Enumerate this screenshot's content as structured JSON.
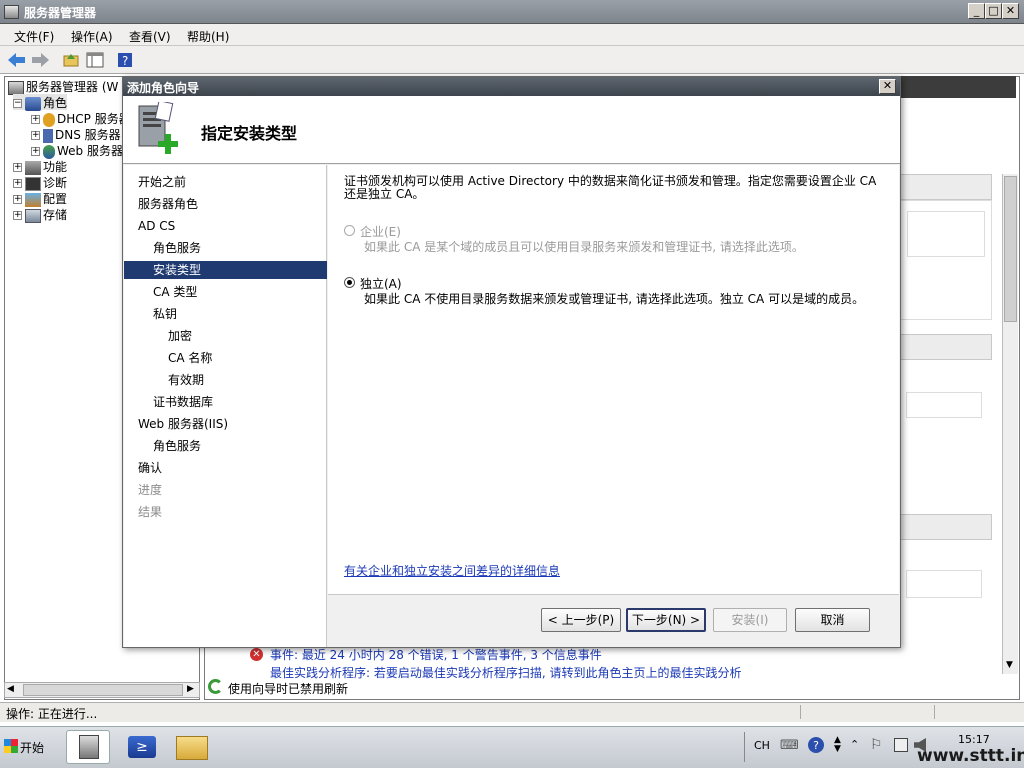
{
  "main_window": {
    "title": "服务器管理器",
    "menu": [
      "文件(F)",
      "操作(A)",
      "查看(V)",
      "帮助(H)"
    ],
    "tree": {
      "root": "服务器管理器 (W",
      "items": [
        {
          "label": "角色",
          "expanded": true
        },
        {
          "label": "DHCP 服务器"
        },
        {
          "label": "DNS 服务器"
        },
        {
          "label": "Web 服务器"
        },
        {
          "label": "功能"
        },
        {
          "label": "诊断"
        },
        {
          "label": "配置"
        },
        {
          "label": "存储"
        }
      ]
    },
    "refresh_notice": "使用向导时已禁用刷新",
    "events_line1": "事件: 最近 24 小时内 28 个错误, 1 个警告事件, 3 个信息事件",
    "events_line2": "最佳实践分析程序: 若要启动最佳实践分析程序扫描, 请转到此角色主页上的最佳实践分析",
    "status": "操作: 正在进行..."
  },
  "dialog": {
    "title": "添加角色向导",
    "heading": "指定安装类型",
    "nav": [
      {
        "label": "开始之前",
        "level": 0,
        "state": "normal"
      },
      {
        "label": "服务器角色",
        "level": 0,
        "state": "normal"
      },
      {
        "label": "AD CS",
        "level": 0,
        "state": "normal"
      },
      {
        "label": "角色服务",
        "level": 1,
        "state": "normal"
      },
      {
        "label": "安装类型",
        "level": 1,
        "state": "selected"
      },
      {
        "label": "CA 类型",
        "level": 1,
        "state": "normal"
      },
      {
        "label": "私钥",
        "level": 1,
        "state": "normal"
      },
      {
        "label": "加密",
        "level": 2,
        "state": "normal"
      },
      {
        "label": "CA 名称",
        "level": 2,
        "state": "normal"
      },
      {
        "label": "有效期",
        "level": 2,
        "state": "normal"
      },
      {
        "label": "证书数据库",
        "level": 1,
        "state": "normal"
      },
      {
        "label": "Web 服务器(IIS)",
        "level": 0,
        "state": "normal"
      },
      {
        "label": "角色服务",
        "level": 1,
        "state": "normal"
      },
      {
        "label": "确认",
        "level": 0,
        "state": "normal"
      },
      {
        "label": "进度",
        "level": 0,
        "state": "disabled"
      },
      {
        "label": "结果",
        "level": 0,
        "state": "disabled"
      }
    ],
    "intro_line1": "证书颁发机构可以使用 Active Directory 中的数据来简化证书颁发和管理。指定您需要设置企业 CA",
    "intro_line2": "还是独立 CA。",
    "options": [
      {
        "label": "企业(E)",
        "desc": "如果此 CA 是某个域的成员且可以使用目录服务来颁发和管理证书, 请选择此选项。",
        "selected": false,
        "enabled": false
      },
      {
        "label": "独立(A)",
        "desc": "如果此 CA 不使用目录服务数据来颁发或管理证书, 请选择此选项。独立 CA 可以是域的成员。",
        "selected": true,
        "enabled": true
      }
    ],
    "link": "有关企业和独立安装之间差异的详细信息",
    "buttons": {
      "back": "< 上一步(P)",
      "next": "下一步(N) >",
      "install": "安装(I)",
      "cancel": "取消"
    }
  },
  "taskbar": {
    "start": "开始",
    "lang": "CH",
    "time": "15:17",
    "watermark": "www.sttt.info"
  }
}
